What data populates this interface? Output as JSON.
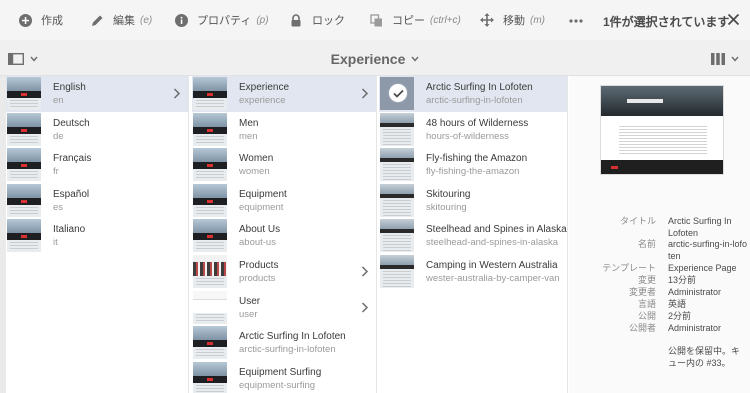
{
  "actionbar": {
    "create": {
      "label": "作成",
      "icon": "plus-circle-icon"
    },
    "edit": {
      "label": "編集",
      "shortcut": "(e)",
      "icon": "pencil-icon"
    },
    "properties": {
      "label": "プロパティ",
      "shortcut": "(p)",
      "icon": "info-icon"
    },
    "lock": {
      "label": "ロック",
      "icon": "lock-icon"
    },
    "copy": {
      "label": "コピー",
      "shortcut": "(ctrl+c)",
      "icon": "copy-icon"
    },
    "move": {
      "label": "移動",
      "shortcut": "(m)",
      "icon": "move-icon"
    },
    "more": {
      "icon": "more-icon"
    },
    "selection_count": "1件が選択されています",
    "close": {
      "icon": "close-icon"
    }
  },
  "titlebar": {
    "title": "Experience",
    "rail_toggle_icon": "rail-toggle-icon",
    "view_toggle_icon": "column-view-icon"
  },
  "columns": [
    {
      "items": [
        {
          "title": "English",
          "name": "en",
          "selected": true,
          "has_children": true
        },
        {
          "title": "Deutsch",
          "name": "de"
        },
        {
          "title": "Français",
          "name": "fr"
        },
        {
          "title": "Español",
          "name": "es"
        },
        {
          "title": "Italiano",
          "name": "it"
        }
      ]
    },
    {
      "items": [
        {
          "title": "Experience",
          "name": "experience",
          "selected": true,
          "has_children": true
        },
        {
          "title": "Men",
          "name": "men"
        },
        {
          "title": "Women",
          "name": "women"
        },
        {
          "title": "Equipment",
          "name": "equipment"
        },
        {
          "title": "About Us",
          "name": "about-us"
        },
        {
          "title": "Products",
          "name": "products",
          "has_children": true
        },
        {
          "title": "User",
          "name": "user",
          "has_children": true
        },
        {
          "title": "Arctic Surfing In Lofoten",
          "name": "arctic-surfing-in-lofoten"
        },
        {
          "title": "Equipment Surfing",
          "name": "equipment-surfing"
        }
      ]
    },
    {
      "items": [
        {
          "title": "Arctic Surfing In Lofoten",
          "name": "arctic-surfing-in-lofoten",
          "selected": true,
          "checked": true
        },
        {
          "title": "48 hours of Wilderness",
          "name": "hours-of-wilderness"
        },
        {
          "title": "Fly-fishing the Amazon",
          "name": "fly-fishing-the-amazon"
        },
        {
          "title": "Skitouring",
          "name": "skitouring"
        },
        {
          "title": "Steelhead and Spines in Alaska",
          "name": "steelhead-and-spines-in-alaska"
        },
        {
          "title": "Camping in Western Australia",
          "name": "wester-australia-by-camper-van"
        }
      ]
    }
  ],
  "meta": {
    "title_label": "タイトル",
    "title_value": "Arctic Surfing In Lofoten",
    "name_label": "名前",
    "name_value": "arctic-surfing-in-lofoten",
    "template_label": "テンプレート",
    "template_value": "Experience Page",
    "modified_label": "変更",
    "modified_value": "13分前",
    "modified_by_label": "変更者",
    "modified_by_value": "Administrator",
    "language_label": "言語",
    "language_value": "英語",
    "published_label": "公開",
    "published_value": "2分前",
    "published_by_label": "公開者",
    "published_by_value": "Administrator",
    "status": "公開を保留中。キュー内の #33。"
  }
}
